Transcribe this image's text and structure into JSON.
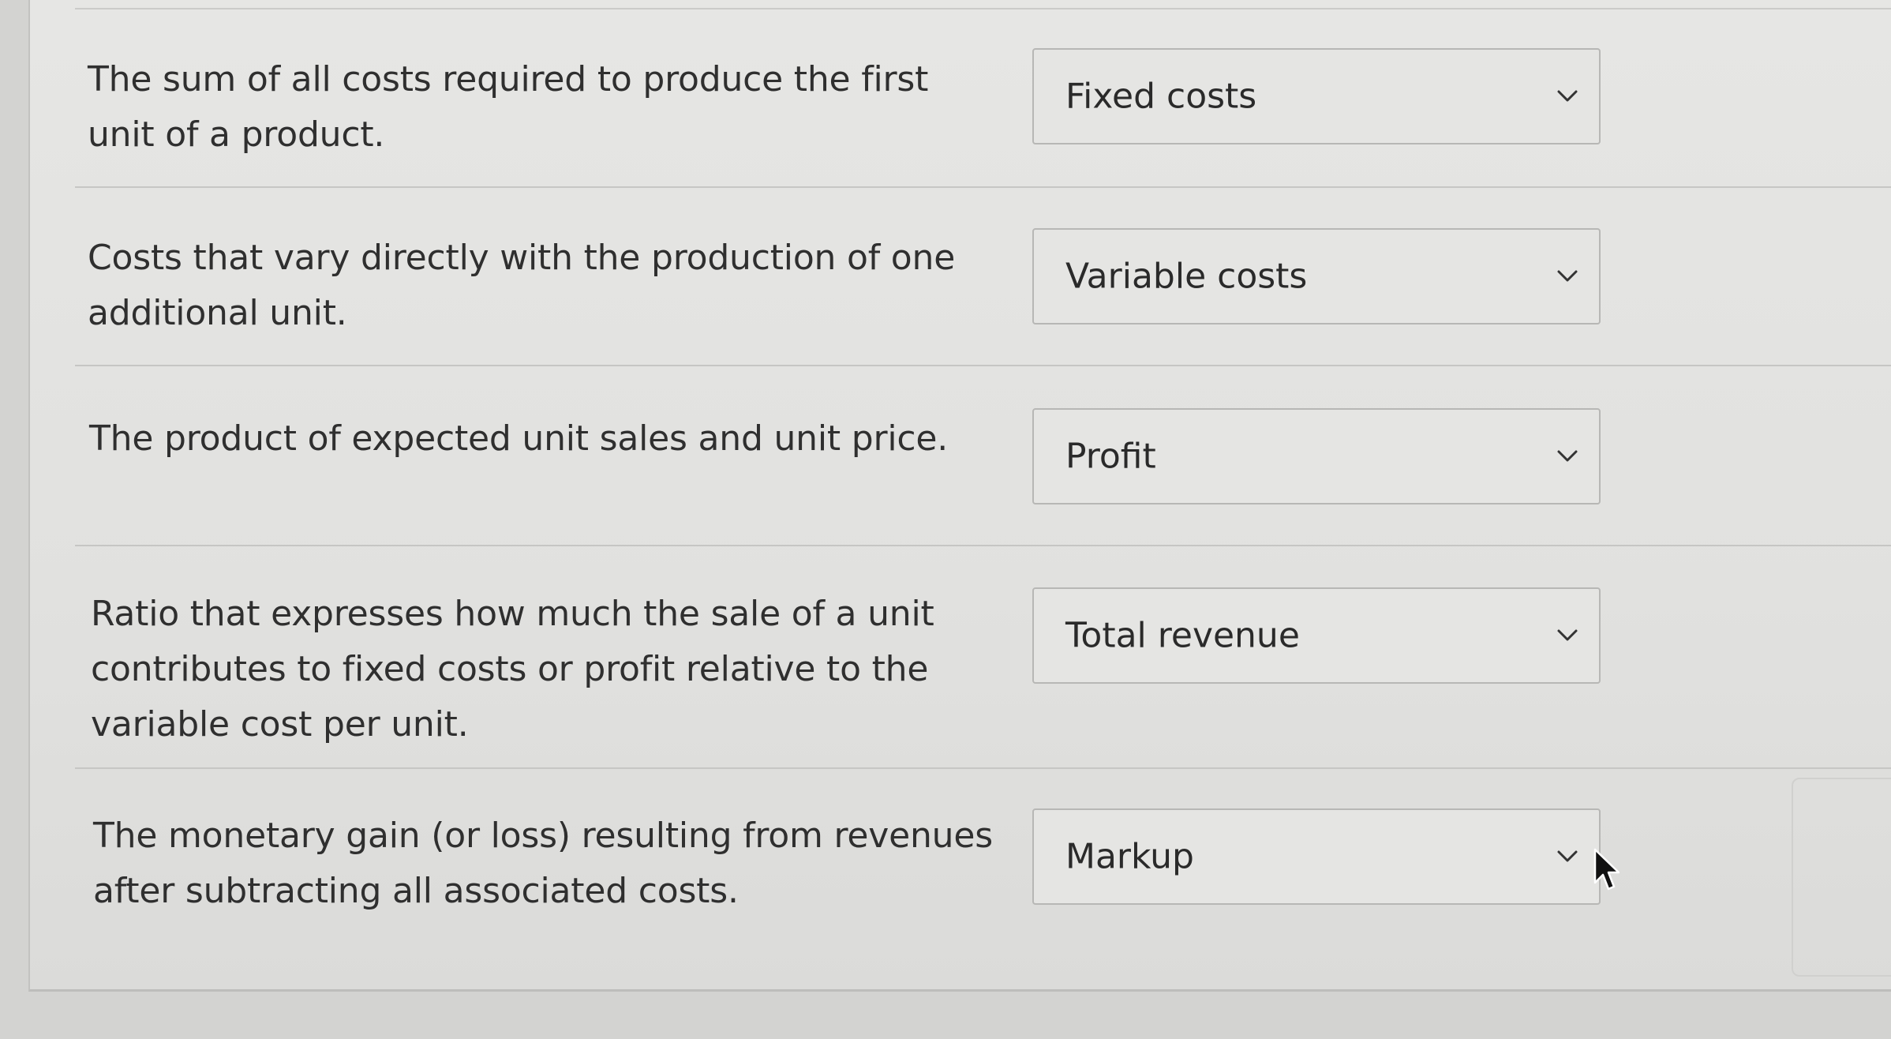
{
  "questions": [
    {
      "prompt": "The sum of all costs required to produce the first unit of a product.",
      "selected": "Fixed costs"
    },
    {
      "prompt": "Costs that vary directly with the production of one additional unit.",
      "selected": "Variable costs"
    },
    {
      "prompt": "The product of expected unit sales and unit price.",
      "selected": "Profit"
    },
    {
      "prompt": "Ratio that expresses how much the sale of a unit contributes to fixed costs or profit relative to the variable cost per unit.",
      "selected": "Total revenue"
    },
    {
      "prompt": "The monetary gain (or loss) resulting from revenues after subtracting all associated costs.",
      "selected": "Markup"
    }
  ],
  "icons": {
    "dropdown": "chevron-down-icon",
    "pointer": "mouse-cursor-icon"
  }
}
